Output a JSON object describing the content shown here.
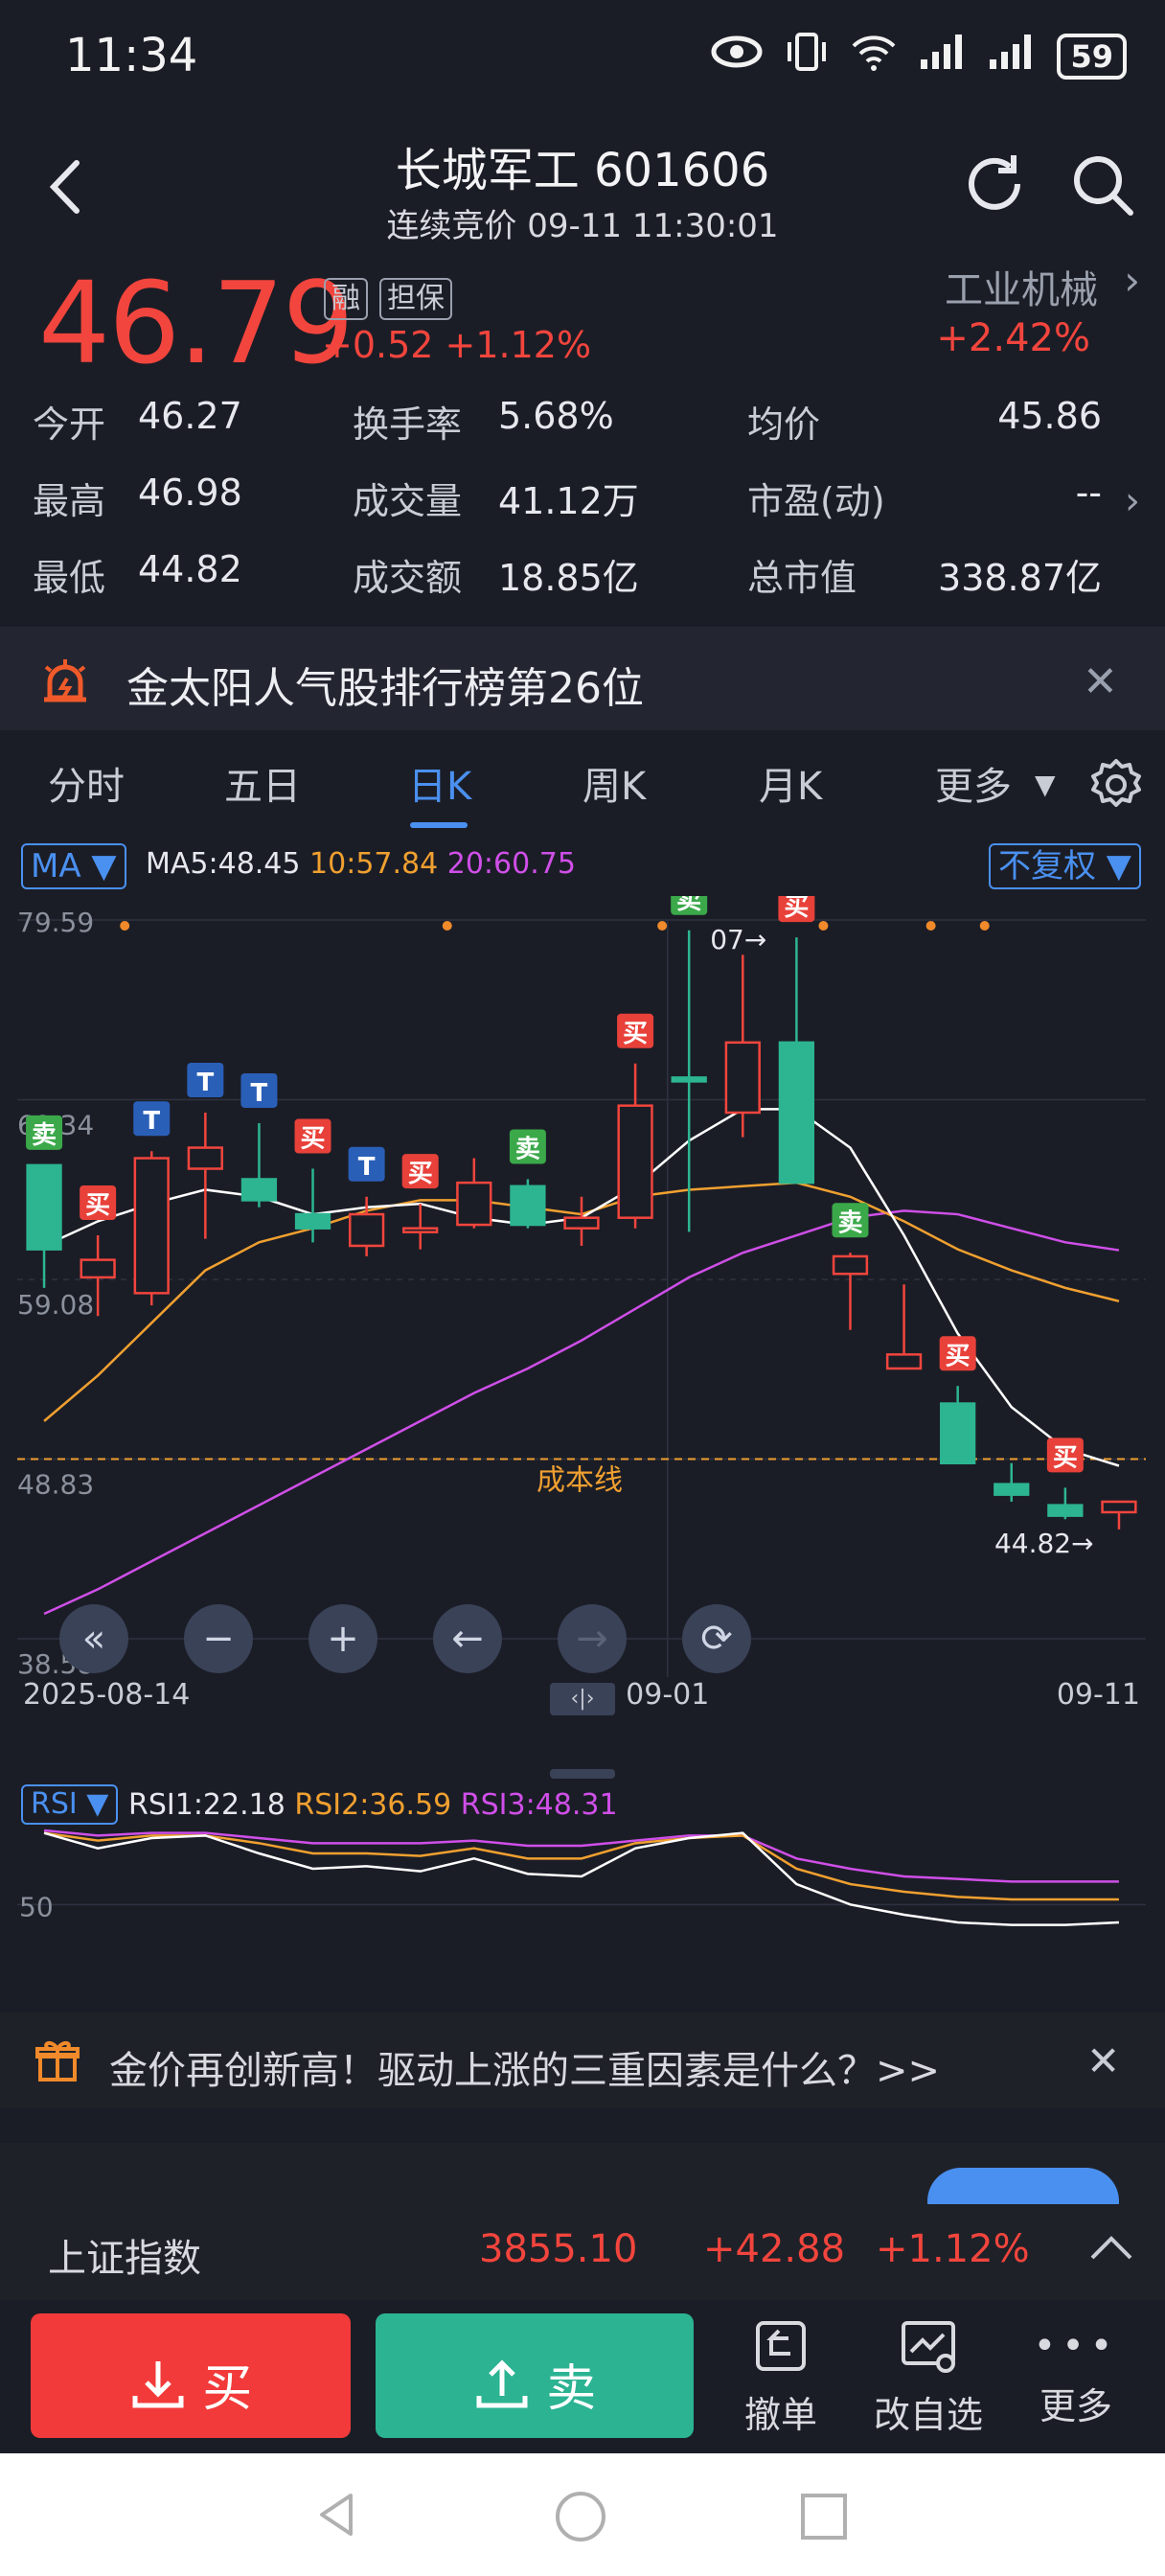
{
  "status_bar": {
    "time": "11:34",
    "battery": "59"
  },
  "header": {
    "title": "长城军工 601606",
    "subtitle": "连续竞价 09-11 11:30:01"
  },
  "quote": {
    "price": "46.79",
    "tag_rong": "融",
    "tag_danbao": "担保",
    "change": "+0.52 +1.12%",
    "sector": "工业机械",
    "sector_change": "+2.42%"
  },
  "stats": {
    "open_label": "今开",
    "open": "46.27",
    "turnover_label": "换手率",
    "turnover": "5.68%",
    "avg_label": "均价",
    "avg": "45.86",
    "high_label": "最高",
    "high": "46.98",
    "volume_label": "成交量",
    "volume": "41.12万",
    "pe_label": "市盈(动)",
    "pe": "--",
    "low_label": "最低",
    "low": "44.82",
    "amount_label": "成交额",
    "amount": "18.85亿",
    "mcap_label": "总市值",
    "mcap": "338.87亿"
  },
  "banner": {
    "text": "金太阳人气股排行榜第26位"
  },
  "tabs": [
    "分时",
    "五日",
    "日K",
    "周K",
    "月K",
    "更多"
  ],
  "active_tab": "日K",
  "chart_controls": {
    "indicator": "MA",
    "ma5": "MA5:48.45",
    "ma10": "10:57.84",
    "ma20": "20:60.75",
    "adjust": "不复权"
  },
  "chart_data": {
    "type": "candlestick",
    "y_ticks": [
      "79.59",
      "69.34",
      "59.08",
      "48.83",
      "38.58"
    ],
    "x_ticks": [
      "2025-08-14",
      "09-01",
      "09-11"
    ],
    "ylim": [
      38.58,
      79.59
    ],
    "cost_line_label": "成本线",
    "cost_line_value": 48.83,
    "high_annotation": "07→",
    "low_annotation": "44.82→",
    "candles": [
      {
        "o": 60.8,
        "h": 64.8,
        "l": 58.6,
        "c": 65.6,
        "up": false
      },
      {
        "o": 59.2,
        "h": 61.6,
        "l": 57.0,
        "c": 60.2,
        "up": true
      },
      {
        "o": 58.3,
        "h": 66.4,
        "l": 57.6,
        "c": 66.0,
        "up": true
      },
      {
        "o": 65.4,
        "h": 68.6,
        "l": 61.4,
        "c": 66.6,
        "up": true
      },
      {
        "o": 64.8,
        "h": 68.0,
        "l": 63.2,
        "c": 63.6,
        "up": false
      },
      {
        "o": 62.8,
        "h": 65.4,
        "l": 61.2,
        "c": 62.0,
        "up": false
      },
      {
        "o": 61.0,
        "h": 63.8,
        "l": 60.4,
        "c": 62.8,
        "up": true
      },
      {
        "o": 62.0,
        "h": 63.4,
        "l": 60.8,
        "c": 62.0,
        "up": true
      },
      {
        "o": 62.2,
        "h": 66.0,
        "l": 62.0,
        "c": 64.6,
        "up": true
      },
      {
        "o": 64.4,
        "h": 64.8,
        "l": 62.0,
        "c": 62.2,
        "up": false
      },
      {
        "o": 62.0,
        "h": 63.8,
        "l": 61.0,
        "c": 62.6,
        "up": true
      },
      {
        "o": 62.6,
        "h": 71.4,
        "l": 62.0,
        "c": 69.0,
        "up": true
      },
      {
        "o": 70.4,
        "h": 79.0,
        "l": 61.8,
        "c": 70.6,
        "up": false
      },
      {
        "o": 68.6,
        "h": 77.6,
        "l": 67.2,
        "c": 72.6,
        "up": true
      },
      {
        "o": 72.6,
        "h": 78.6,
        "l": 65.0,
        "c": 64.6,
        "up": false
      },
      {
        "o": 60.4,
        "h": 60.6,
        "l": 56.2,
        "c": 59.4,
        "up": true
      },
      {
        "o": 54.0,
        "h": 58.8,
        "l": 54.0,
        "c": 54.8,
        "up": true
      },
      {
        "o": 52.0,
        "h": 53.0,
        "l": 48.8,
        "c": 48.6,
        "up": false
      },
      {
        "o": 47.4,
        "h": 48.6,
        "l": 46.4,
        "c": 46.8,
        "up": false
      },
      {
        "o": 46.2,
        "h": 47.2,
        "l": 45.4,
        "c": 45.6,
        "up": false
      },
      {
        "o": 45.8,
        "h": 46.4,
        "l": 44.82,
        "c": 46.4,
        "up": true
      }
    ],
    "ma5": [
      61.0,
      62.4,
      63.4,
      64.2,
      63.8,
      62.8,
      63.2,
      63.4,
      62.6,
      62.2,
      62.6,
      64.4,
      67.0,
      68.8,
      68.8,
      66.6,
      61.6,
      56.0,
      51.8,
      49.4,
      48.45
    ],
    "ma10": [
      51.0,
      53.6,
      56.6,
      59.6,
      61.2,
      62.0,
      63.0,
      63.6,
      63.6,
      63.2,
      62.8,
      63.8,
      64.2,
      64.4,
      64.6,
      63.8,
      62.4,
      60.8,
      59.6,
      58.6,
      57.84
    ],
    "ma20": [
      40.0,
      41.4,
      43.0,
      44.6,
      46.2,
      47.8,
      49.4,
      51.0,
      52.6,
      54.0,
      55.6,
      57.4,
      59.2,
      60.6,
      61.6,
      62.6,
      63.0,
      62.8,
      62.0,
      61.2,
      60.75
    ],
    "signals": [
      "卖",
      "买",
      "T",
      "T",
      "T",
      "买",
      "T",
      "买",
      "",
      "卖",
      "",
      "买",
      "卖",
      "",
      "买",
      "卖",
      "",
      "买",
      "",
      "买",
      ""
    ],
    "rsi": {
      "label": "RSI",
      "rsi1": "RSI1:22.18",
      "rsi2": "RSI2:36.59",
      "rsi3": "RSI3:48.31",
      "tick_50": "50",
      "rsi1_values": [
        78,
        72,
        76,
        77,
        70,
        64,
        65,
        63,
        68,
        62,
        61,
        72,
        76,
        78,
        58,
        50,
        46,
        43,
        42,
        42,
        43
      ],
      "rsi2_values": [
        78,
        75,
        77,
        77,
        74,
        70,
        70,
        69,
        72,
        68,
        68,
        74,
        76,
        77,
        64,
        58,
        55,
        53,
        52,
        52,
        52
      ],
      "rsi3_values": [
        79,
        77,
        78,
        78,
        76,
        74,
        74,
        74,
        75,
        73,
        73,
        75,
        77,
        77,
        68,
        64,
        61,
        60,
        59,
        59,
        59
      ]
    }
  },
  "news": {
    "text": "金价再创新高！驱动上涨的三重因素是什么？>>"
  },
  "index_bar": {
    "name": "上证指数",
    "value": "3855.10",
    "change": "+42.88",
    "pct": "+1.12%"
  },
  "actions": {
    "buy": "买",
    "sell": "卖",
    "cancel": "撤单",
    "watchlist": "改自选",
    "more": "更多"
  },
  "colors": {
    "up": "#f2453d",
    "down": "#2db592",
    "ma5": "#ffffff",
    "ma10": "#f0a030",
    "ma20": "#cf4fe8",
    "accent": "#4a90f0"
  }
}
